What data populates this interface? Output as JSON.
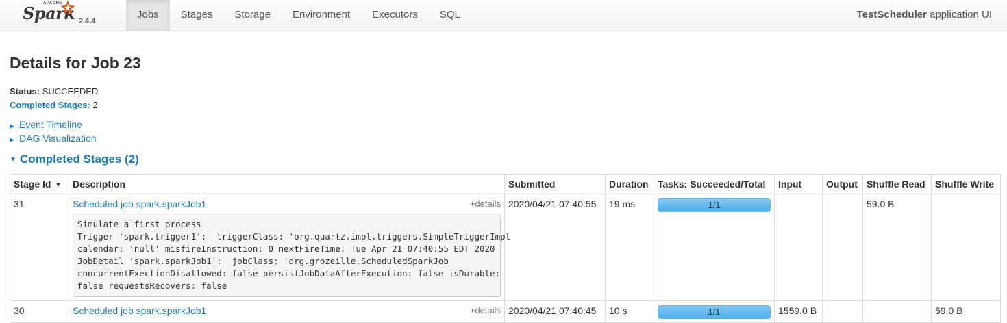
{
  "navbar": {
    "brand_apache": "APACHE",
    "brand_name": "Spark",
    "version": "2.4.4",
    "tabs": [
      {
        "label": "Jobs",
        "active": true
      },
      {
        "label": "Stages",
        "active": false
      },
      {
        "label": "Storage",
        "active": false
      },
      {
        "label": "Environment",
        "active": false
      },
      {
        "label": "Executors",
        "active": false
      },
      {
        "label": "SQL",
        "active": false
      }
    ],
    "app_name": "TestScheduler",
    "app_suffix": "application UI"
  },
  "page": {
    "title": "Details for Job 23",
    "status_label": "Status:",
    "status_value": "SUCCEEDED",
    "completed_label": "Completed Stages:",
    "completed_value": "2",
    "event_timeline": "Event Timeline",
    "dag_visualization": "DAG Visualization",
    "section_title": "Completed Stages (2)"
  },
  "table": {
    "headers": [
      "Stage Id",
      "Description",
      "Submitted",
      "Duration",
      "Tasks: Succeeded/Total",
      "Input",
      "Output",
      "Shuffle Read",
      "Shuffle Write"
    ],
    "details_label": "+details",
    "rows": [
      {
        "stage_id": "31",
        "description": "Scheduled job spark.sparkJob1",
        "details_text": "Simulate a first process\nTrigger 'spark.trigger1':  triggerClass: 'org.quartz.impl.triggers.SimpleTriggerImpl\ncalendar: 'null' misfireInstruction: 0 nextFireTime: Tue Apr 21 07:40:55 EDT 2020\nJobDetail 'spark.sparkJob1':  jobClass: 'org.grozeille.ScheduledSparkJob\nconcurrentExectionDisallowed: false persistJobDataAfterExecution: false isDurable:\nfalse requestsRecovers: false",
        "submitted": "2020/04/21 07:40:55",
        "duration": "19 ms",
        "tasks": "1/1",
        "tasks_fraction": 1.0,
        "input": "",
        "output": "",
        "shuffle_read": "59.0 B",
        "shuffle_write": ""
      },
      {
        "stage_id": "30",
        "description": "Scheduled job spark.sparkJob1",
        "submitted": "2020/04/21 07:40:45",
        "duration": "10 s",
        "tasks": "1/1",
        "tasks_fraction": 1.0,
        "input": "1559.0 B",
        "output": "",
        "shuffle_read": "",
        "shuffle_write": "59.0 B"
      }
    ]
  }
}
